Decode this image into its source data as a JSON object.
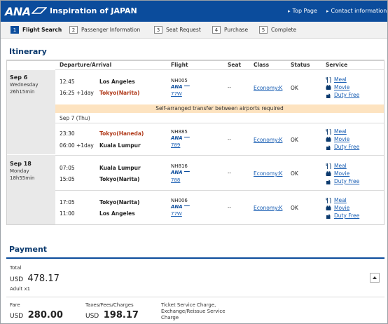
{
  "header": {
    "logo": "ANA",
    "site_title": "Inspiration of JAPAN",
    "links": [
      {
        "bullet": "▸",
        "label": "Top Page"
      },
      {
        "bullet": "▸",
        "label": "Contact information"
      }
    ],
    "brand_color": "#0b4c9c"
  },
  "steps": [
    {
      "num": "1",
      "label": "Flight Search",
      "active": true
    },
    {
      "num": "2",
      "label": "Passenger Information",
      "active": false
    },
    {
      "num": "3",
      "label": "Seat Request",
      "active": false
    },
    {
      "num": "4",
      "label": "Purchase",
      "active": false
    },
    {
      "num": "5",
      "label": "Complete",
      "active": false
    }
  ],
  "itinerary": {
    "title": "Itinerary",
    "columns": {
      "dep_arr": "Departure/Arrival",
      "flight": "Flight",
      "seat": "Seat",
      "class": "Class",
      "status": "Status",
      "service": "Service"
    },
    "days": [
      {
        "date": "Sep 6",
        "weekday": "Wednesday",
        "duration": "26h15min"
      },
      {
        "date": "Sep 18",
        "weekday": "Monday",
        "duration": "18h55min"
      }
    ],
    "transfer_note": "Self-arranged transfer between airports required",
    "sub_date": "Sep 7 (Thu)",
    "airline_mark": "ANA",
    "services": {
      "meal": "Meal",
      "movie": "Movie",
      "duty_free": "Duty Free"
    },
    "segments": [
      {
        "dep_time": "12:45",
        "dep_city": "Los Angeles",
        "arr_time": "16:25 +1day",
        "arr_city": "Tokyo(Narita)",
        "flight": "NH005",
        "aircraft": "77W",
        "seat": "--",
        "class": "Economy:K",
        "status": "OK"
      },
      {
        "dep_time": "23:30",
        "dep_city": "Tokyo(Haneda)",
        "arr_time": "06:00 +1day",
        "arr_city": "Kuala Lumpur",
        "flight": "NH885",
        "aircraft": "789",
        "seat": "--",
        "class": "Economy:K",
        "status": "OK"
      },
      {
        "dep_time": "07:05",
        "dep_city": "Kuala Lumpur",
        "arr_time": "15:05",
        "arr_city": "Tokyo(Narita)",
        "flight": "NH816",
        "aircraft": "788",
        "seat": "--",
        "class": "Economy:K",
        "status": "OK"
      },
      {
        "dep_time": "17:05",
        "dep_city": "Tokyo(Narita)",
        "arr_time": "11:00",
        "arr_city": "Los Angeles",
        "flight": "NH006",
        "aircraft": "77W",
        "seat": "--",
        "class": "Economy:K",
        "status": "OK"
      }
    ]
  },
  "payment": {
    "title": "Payment",
    "total_label": "Total",
    "currency": "USD",
    "total": "478.17",
    "passengers": "Adult x1",
    "fare_label": "Fare",
    "fare": "280.00",
    "taxes_label": "Taxes/Fees/Charges",
    "taxes": "198.17",
    "ticket_charge_label": "Ticket Service Charge, Exchange/Reissue Service Charge"
  }
}
